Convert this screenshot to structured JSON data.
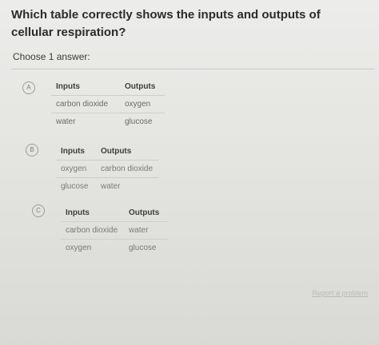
{
  "question": {
    "text": "Which table correctly shows the inputs and outputs of cellular respiration?"
  },
  "instruction": "Choose 1 answer:",
  "choices": [
    {
      "letter": "A",
      "headers": [
        "Inputs",
        "Outputs"
      ],
      "rows": [
        [
          "carbon dioxide",
          "oxygen"
        ],
        [
          "water",
          "glucose"
        ]
      ]
    },
    {
      "letter": "B",
      "headers": [
        "Inputs",
        "Outputs"
      ],
      "rows": [
        [
          "oxygen",
          "carbon dioxide"
        ],
        [
          "glucose",
          "water"
        ]
      ]
    },
    {
      "letter": "C",
      "headers": [
        "Inputs",
        "Outputs"
      ],
      "rows": [
        [
          "carbon dioxide",
          "water"
        ],
        [
          "oxygen",
          "glucose"
        ]
      ]
    }
  ],
  "footer": {
    "report_label": "Report a problem"
  }
}
